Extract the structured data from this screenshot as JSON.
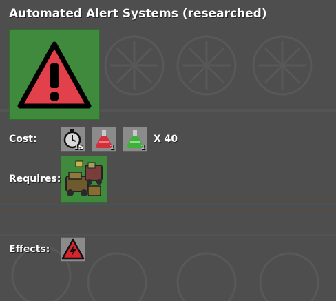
{
  "title": "Automated Alert Systems (researched)",
  "tech_icon": "warning-triangle-icon",
  "cost": {
    "label": "Cost:",
    "items": [
      {
        "icon": "stopwatch-time-icon",
        "count": "15"
      },
      {
        "icon": "red-science-pack-icon",
        "count": "1"
      },
      {
        "icon": "green-science-pack-icon",
        "count": "1"
      }
    ],
    "multiplier": "X 40"
  },
  "requires": {
    "label": "Requires:",
    "icon": "military-vehicles-tech-icon"
  },
  "effects": {
    "label": "Effects:",
    "icon": "power-alert-icon"
  }
}
